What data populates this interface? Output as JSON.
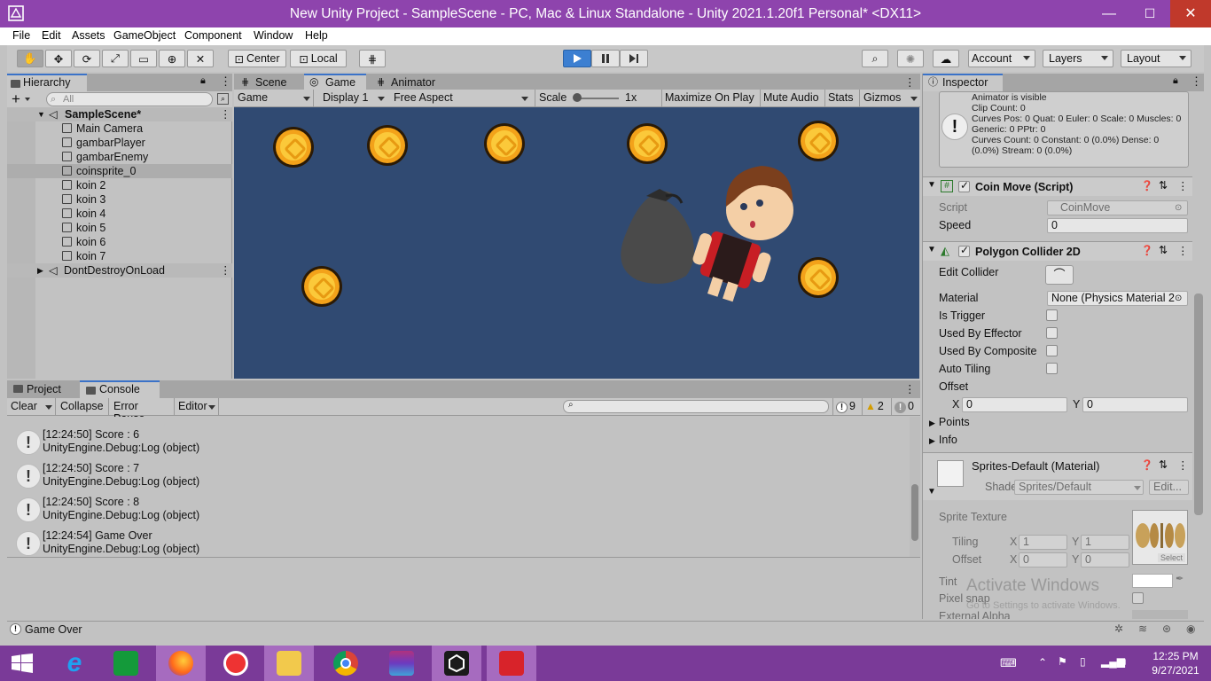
{
  "window": {
    "title": "New Unity Project - SampleScene - PC, Mac & Linux Standalone - Unity 2021.1.20f1 Personal* <DX11>",
    "minimize": "—",
    "maximize": "☐",
    "close": "✕"
  },
  "menu": [
    "File",
    "Edit",
    "Assets",
    "GameObject",
    "Component",
    "Window",
    "Help"
  ],
  "toolbar": {
    "center": "Center",
    "local": "Local",
    "account": "Account",
    "layers": "Layers",
    "layout": "Layout"
  },
  "hierarchy": {
    "tab": "Hierarchy",
    "search_placeholder": "All",
    "scene": "SampleScene*",
    "items": [
      "Main Camera",
      "gambarPlayer",
      "gambarEnemy",
      "coinsprite_0",
      "koin 2",
      "koin 3",
      "koin 4",
      "koin 5",
      "koin 6",
      "koin 7"
    ],
    "selected_index": 3,
    "dontdestroy": "DontDestroyOnLoad"
  },
  "center_tabs": {
    "scene": "Scene",
    "game": "Game",
    "animator": "Animator"
  },
  "game_toolbar": {
    "game": "Game",
    "display": "Display 1",
    "aspect": "Free Aspect",
    "scale_label": "Scale",
    "scale_value": "1x",
    "maximize": "Maximize On Play",
    "mute": "Mute Audio",
    "stats": "Stats",
    "gizmos": "Gizmos"
  },
  "bottom_tabs": {
    "project": "Project",
    "console": "Console"
  },
  "console_toolbar": {
    "clear": "Clear",
    "collapse": "Collapse",
    "error_pause": "Error Pause",
    "editor": "Editor",
    "log_count": "9",
    "warn_count": "2",
    "error_count": "0"
  },
  "console_logs": [
    {
      "line1": "[12:24:50] Score : 6",
      "line2": "UnityEngine.Debug:Log (object)"
    },
    {
      "line1": "[12:24:50] Score : 7",
      "line2": "UnityEngine.Debug:Log (object)"
    },
    {
      "line1": "[12:24:50] Score : 8",
      "line2": "UnityEngine.Debug:Log (object)"
    },
    {
      "line1": "[12:24:54] Game Over",
      "line2": "UnityEngine.Debug:Log (object)"
    }
  ],
  "inspector": {
    "tab": "Inspector",
    "animator_info": [
      "Animator is visible",
      "Clip Count: 0",
      "Curves Pos: 0 Quat: 0 Euler: 0 Scale: 0 Muscles: 0",
      "Generic: 0 PPtr: 0",
      "Curves Count: 0 Constant: 0 (0.0%) Dense: 0",
      "(0.0%) Stream: 0 (0.0%)"
    ],
    "coinmove": {
      "title": "Coin Move (Script)",
      "script_label": "Script",
      "script_value": "CoinMove",
      "speed_label": "Speed",
      "speed_value": "0"
    },
    "collider": {
      "title": "Polygon Collider 2D",
      "edit_collider": "Edit Collider",
      "material_label": "Material",
      "material_value": "None (Physics Material 2",
      "is_trigger": "Is Trigger",
      "used_by_effector": "Used By Effector",
      "used_by_composite": "Used By Composite",
      "auto_tiling": "Auto Tiling",
      "offset": "Offset",
      "x_label": "X",
      "x_value": "0",
      "y_label": "Y",
      "y_value": "0",
      "points": "Points",
      "info": "Info"
    },
    "material": {
      "title": "Sprites-Default (Material)",
      "shader_label": "Shader",
      "shader_value": "Sprites/Default",
      "edit": "Edit...",
      "sprite_texture": "Sprite Texture",
      "tiling": "Tiling",
      "tiling_x": "1",
      "tiling_y": "1",
      "offset": "Offset",
      "offset_x": "0",
      "offset_y": "0",
      "x": "X",
      "y": "Y",
      "select": "Select",
      "tint": "Tint",
      "pixel_snap": "Pixel snap",
      "external_alpha": "External Alpha"
    }
  },
  "watermark": {
    "line1": "Activate Windows",
    "line2": "Go to Settings to activate Windows."
  },
  "status": {
    "message": "Game Over"
  },
  "taskbar": {
    "time": "12:25 PM",
    "date": "9/27/2021"
  }
}
